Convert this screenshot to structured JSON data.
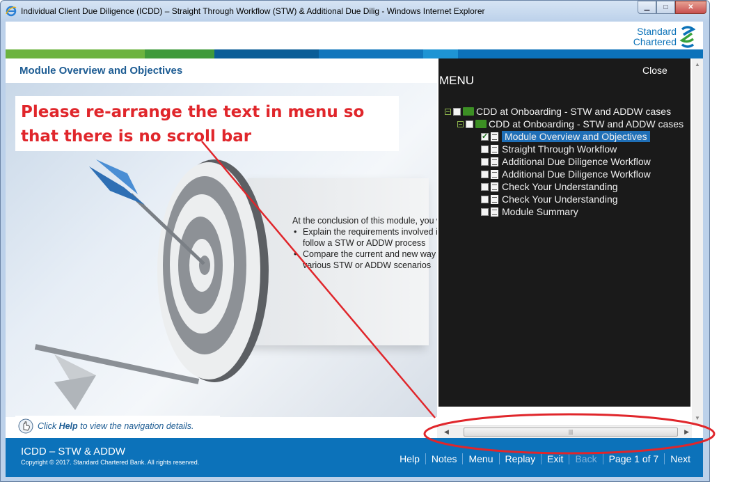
{
  "window": {
    "title": "Individual Client Due Diligence (ICDD) – Straight Through Workflow (STW) & Additional Due Dilig - Windows Internet Explorer"
  },
  "brand": {
    "logo_line1": "Standard",
    "logo_line2": "Chartered"
  },
  "stripe_colors": [
    "#6cb33f",
    "#3f9a3b",
    "#0a5d97",
    "#1176bc",
    "#1e94d4",
    "#0c72ba"
  ],
  "module": {
    "title": "Module Overview and Objectives",
    "intro": "At the conclusion of this module, you will be able to:",
    "objectives": [
      "Explain the requirements involved in classifying the CDD case to follow a STW or ADDW process",
      "Compare the current and new way of processing CDD case file in various STW or ADDW scenarios"
    ]
  },
  "annotation": {
    "text": "Please re-arrange the text in menu so that there is no scroll bar",
    "color": "#e0262b"
  },
  "help": {
    "prefix": "Click ",
    "bold": "Help",
    "suffix": " to view the navigation details."
  },
  "menu": {
    "heading": "MENU",
    "close_label": "Close",
    "root": "CDD at Onboarding - STW and ADDW cases",
    "child": "CDD at Onboarding - STW and ADDW cases",
    "items": [
      {
        "label": "Module Overview and Objectives",
        "selected": true,
        "checked": true
      },
      {
        "label": "Straight Through Workflow",
        "selected": false,
        "checked": false
      },
      {
        "label": "Additional Due Diligence Workflow",
        "selected": false,
        "checked": false
      },
      {
        "label": "Additional Due Diligence Workflow",
        "selected": false,
        "checked": false
      },
      {
        "label": "Check Your Understanding",
        "selected": false,
        "checked": false
      },
      {
        "label": "Check Your Understanding",
        "selected": false,
        "checked": false
      },
      {
        "label": "Module Summary",
        "selected": false,
        "checked": false
      }
    ]
  },
  "footer": {
    "course_title": "ICDD – STW & ADDW",
    "copyright": "Copyright © 2017. Standard Chartered Bank. All rights reserved.",
    "nav": {
      "help": "Help",
      "notes": "Notes",
      "menu": "Menu",
      "replay": "Replay",
      "exit": "Exit",
      "back": "Back",
      "page": "Page 1 of 7",
      "next": "Next"
    }
  }
}
